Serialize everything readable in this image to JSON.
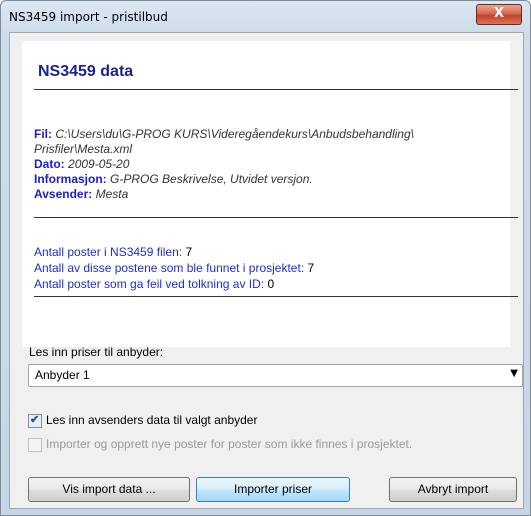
{
  "window": {
    "title": "NS3459 import - pristilbud",
    "close_label": "X"
  },
  "panel": {
    "heading": "NS3459 data",
    "file_label": "Fil:",
    "file_value_line1": "C:\\Users\\du\\G-PROG KURS\\Videregåendekurs\\Anbudsbehandling\\",
    "file_value_line2": "Prisfiler\\Mesta.xml",
    "date_label": "Dato:",
    "date_value": "2009-05-20",
    "info_label": "Informasjon:",
    "info_value": "G-PROG Beskrivelse, Utvidet versjon.",
    "sender_label": "Avsender:",
    "sender_value": "Mesta",
    "stats": [
      {
        "label": "Antall poster i NS3459 filen:",
        "value": "7"
      },
      {
        "label": "Antall av disse postene som ble funnet i prosjektet:",
        "value": "7"
      },
      {
        "label": "Antall poster som ga feil ved tolkning av ID:",
        "value": "0"
      }
    ]
  },
  "bidder": {
    "label": "Les inn priser til anbyder:",
    "selected": "Anbyder 1"
  },
  "options": {
    "read_sender": {
      "label": "Les inn avsenders data til valgt anbyder",
      "checked": true
    },
    "import_create": {
      "label": "Importer og opprett nye poster for poster som ikke finnes i prosjektet.",
      "checked": false
    }
  },
  "buttons": {
    "view": "Vis import data ...",
    "import": "Importer priser",
    "cancel": "Avbryt import"
  }
}
